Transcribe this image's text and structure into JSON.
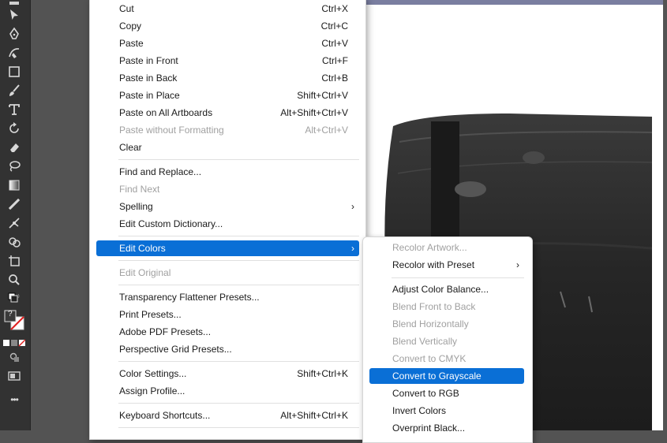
{
  "toolbar": {
    "tools": [
      {
        "name": "selection-tool",
        "icon": "black-arrow-icon"
      },
      {
        "name": "pen-tool",
        "icon": "pen-icon"
      },
      {
        "name": "curvature-tool",
        "icon": "curvature-pen-icon"
      },
      {
        "name": "rectangle-tool",
        "icon": "rectangle-icon"
      },
      {
        "name": "paintbrush-tool",
        "icon": "brush-icon"
      },
      {
        "name": "type-tool",
        "icon": "type-icon"
      },
      {
        "name": "rotate-tool",
        "icon": "rotate-icon"
      },
      {
        "name": "eraser-tool",
        "icon": "eraser-icon"
      },
      {
        "name": "lasso-tool",
        "icon": "lasso-icon"
      },
      {
        "name": "gradient-tool",
        "icon": "gradient-icon"
      },
      {
        "name": "eyedropper-tool",
        "icon": "eyedropper-icon"
      },
      {
        "name": "puppet-warp-tool",
        "icon": "puppet-icon"
      },
      {
        "name": "shape-builder-tool",
        "icon": "shape-builder-icon"
      },
      {
        "name": "artboard-tool",
        "icon": "artboard-icon"
      },
      {
        "name": "zoom-tool",
        "icon": "magnifier-icon"
      }
    ],
    "unknown_label": "?",
    "more_label": "•••"
  },
  "main_menu": {
    "items": [
      {
        "label": "Cut",
        "shortcut": "Ctrl+X",
        "disabled": false
      },
      {
        "label": "Copy",
        "shortcut": "Ctrl+C",
        "disabled": false
      },
      {
        "label": "Paste",
        "shortcut": "Ctrl+V",
        "disabled": false
      },
      {
        "label": "Paste in Front",
        "shortcut": "Ctrl+F",
        "disabled": false
      },
      {
        "label": "Paste in Back",
        "shortcut": "Ctrl+B",
        "disabled": false
      },
      {
        "label": "Paste in Place",
        "shortcut": "Shift+Ctrl+V",
        "disabled": false
      },
      {
        "label": "Paste on All Artboards",
        "shortcut": "Alt+Shift+Ctrl+V",
        "disabled": false
      },
      {
        "label": "Paste without Formatting",
        "shortcut": "Alt+Ctrl+V",
        "disabled": true
      },
      {
        "label": "Clear",
        "shortcut": "",
        "disabled": false
      },
      {
        "label": "Find and Replace...",
        "shortcut": "",
        "disabled": false
      },
      {
        "label": "Find Next",
        "shortcut": "",
        "disabled": true
      },
      {
        "label": "Spelling",
        "shortcut": "",
        "disabled": false,
        "submenu": true
      },
      {
        "label": "Edit Custom Dictionary...",
        "shortcut": "",
        "disabled": false
      },
      {
        "label": "Edit Colors",
        "shortcut": "",
        "disabled": false,
        "submenu": true,
        "highlighted": true
      },
      {
        "label": "Edit Original",
        "shortcut": "",
        "disabled": true
      },
      {
        "label": "Transparency Flattener Presets...",
        "shortcut": "",
        "disabled": false
      },
      {
        "label": "Print Presets...",
        "shortcut": "",
        "disabled": false
      },
      {
        "label": "Adobe PDF Presets...",
        "shortcut": "",
        "disabled": false
      },
      {
        "label": "Perspective Grid Presets...",
        "shortcut": "",
        "disabled": false
      },
      {
        "label": "Color Settings...",
        "shortcut": "Shift+Ctrl+K",
        "disabled": false
      },
      {
        "label": "Assign Profile...",
        "shortcut": "",
        "disabled": false
      },
      {
        "label": "Keyboard Shortcuts...",
        "shortcut": "Alt+Shift+Ctrl+K",
        "disabled": false
      }
    ]
  },
  "edit_colors_submenu": {
    "items": [
      {
        "label": "Recolor Artwork...",
        "disabled": true
      },
      {
        "label": "Recolor with Preset",
        "disabled": false,
        "submenu": true
      },
      {
        "label": "Adjust Color Balance...",
        "disabled": false
      },
      {
        "label": "Blend Front to Back",
        "disabled": true
      },
      {
        "label": "Blend Horizontally",
        "disabled": true
      },
      {
        "label": "Blend Vertically",
        "disabled": true
      },
      {
        "label": "Convert to CMYK",
        "disabled": true
      },
      {
        "label": "Convert to Grayscale",
        "disabled": false,
        "highlighted": true
      },
      {
        "label": "Convert to RGB",
        "disabled": false
      },
      {
        "label": "Invert Colors",
        "disabled": false
      },
      {
        "label": "Overprint Black...",
        "disabled": false
      }
    ]
  },
  "colors": {
    "highlight": "#0a6fd6",
    "toolbar_bg": "#323232",
    "workspace_bg": "#535353",
    "disabled_text": "#a0a0a0"
  }
}
